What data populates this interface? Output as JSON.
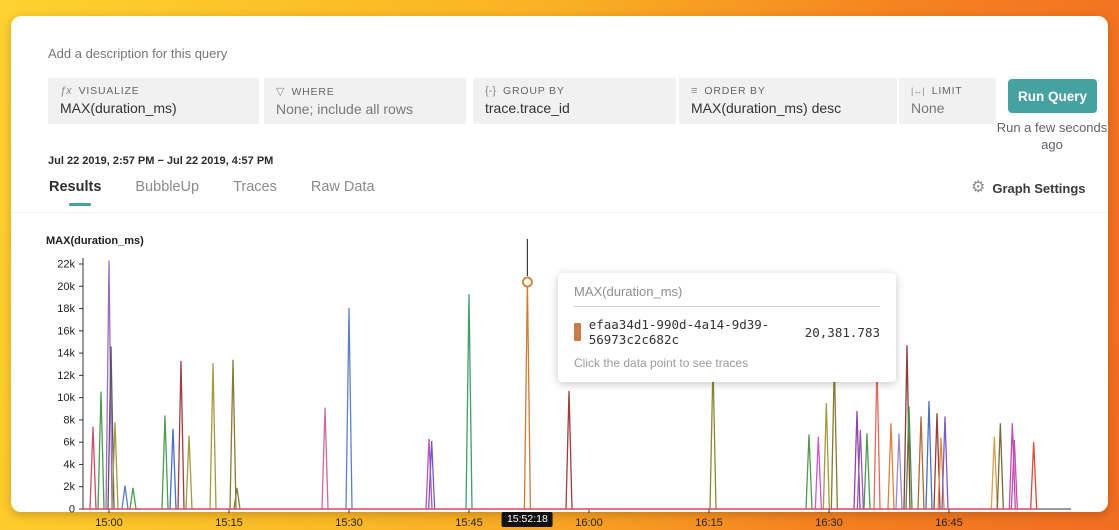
{
  "description_placeholder": "Add a description for this query",
  "query_builder": {
    "visualize": {
      "label": "VISUALIZE",
      "icon": "ƒx",
      "value": "MAX(duration_ms)"
    },
    "where": {
      "label": "WHERE",
      "icon": "▽",
      "value": "None; include all rows"
    },
    "group_by": {
      "label": "GROUP BY",
      "icon": "{-}",
      "value": "trace.trace_id"
    },
    "order_by": {
      "label": "ORDER BY",
      "icon": "≡",
      "value": "MAX(duration_ms) desc"
    },
    "limit": {
      "label": "LIMIT",
      "icon": "|↔|",
      "value": "None"
    },
    "run_button_label": "Run Query",
    "last_run_status": "Run a few seconds ago"
  },
  "time_range": "Jul 22 2019, 2:57 PM − Jul 22 2019, 4:57 PM",
  "tabs": [
    {
      "label": "Results",
      "active": true
    },
    {
      "label": "BubbleUp",
      "active": false
    },
    {
      "label": "Traces",
      "active": false
    },
    {
      "label": "Raw Data",
      "active": false
    }
  ],
  "graph_settings_label": "Graph Settings",
  "gear_icon": "⚙",
  "tooltip": {
    "title": "MAX(duration_ms)",
    "series_id": "efaa34d1-990d-4a14-9d39-56973c2c682c",
    "value": "20,381.783",
    "swatch_color": "#c87d4a",
    "hint": "Click the data point to see traces"
  },
  "selected_time_badge": "15:52:18",
  "colors": {
    "accent_teal": "#45a2a1",
    "zero_line_red": "#e0475a",
    "selected_orange": "#d07c35",
    "axis": "#333333"
  },
  "chart_data": {
    "type": "line",
    "title": "MAX(duration_ms)",
    "ylabel": "MAX(duration_ms)",
    "ylim": [
      0,
      22000
    ],
    "y_tick_labels": [
      "0",
      "2k",
      "4k",
      "6k",
      "8k",
      "10k",
      "12k",
      "14k",
      "16k",
      "18k",
      "20k",
      "22k"
    ],
    "x_ticks": [
      "15:00",
      "15:15",
      "15:30",
      "15:45",
      "16:00",
      "16:15",
      "16:30",
      "16:45"
    ],
    "grid": false,
    "legend": "tooltip-only",
    "points": [
      [
        "14:58:00",
        7400,
        "#c8506a"
      ],
      [
        "14:59:00",
        10550,
        "#4f9a4f"
      ],
      [
        "15:00:00",
        22300,
        "#9a6cc0"
      ],
      [
        "15:00:15",
        14600,
        "#5c5470"
      ],
      [
        "15:00:45",
        7800,
        "#a39a40"
      ],
      [
        "15:02:00",
        2100,
        "#5b7fc4"
      ],
      [
        "15:03:00",
        1900,
        "#4f9a4f"
      ],
      [
        "15:07:00",
        8400,
        "#4f9a4f"
      ],
      [
        "15:08:00",
        7200,
        "#4a6fc8"
      ],
      [
        "15:09:00",
        13300,
        "#a03c46"
      ],
      [
        "15:10:00",
        6600,
        "#a39a40"
      ],
      [
        "15:13:00",
        13100,
        "#a39a40"
      ],
      [
        "15:15:30",
        13400,
        "#8a7a35"
      ],
      [
        "15:16:00",
        1900,
        "#8a7a35"
      ],
      [
        "15:27:00",
        9100,
        "#d0689e"
      ],
      [
        "15:30:00",
        18050,
        "#5b82c8"
      ],
      [
        "15:40:00",
        6300,
        "#bc4fc4"
      ],
      [
        "15:40:20",
        6100,
        "#6c5bd0"
      ],
      [
        "15:45:00",
        19300,
        "#3f9d6e"
      ],
      [
        "15:52:18",
        20381.783,
        "#d07c35"
      ],
      [
        "15:57:30",
        10600,
        "#a03c3c"
      ],
      [
        "16:15:30",
        13100,
        "#8f8436"
      ],
      [
        "16:27:30",
        6700,
        "#4f9a4f"
      ],
      [
        "16:28:40",
        6500,
        "#d354c6"
      ],
      [
        "16:29:40",
        9500,
        "#a39a40"
      ],
      [
        "16:30:40",
        13100,
        "#857a30"
      ],
      [
        "16:33:30",
        8800,
        "#8e44ad"
      ],
      [
        "16:33:55",
        7100,
        "#9b59b6"
      ],
      [
        "16:34:45",
        6800,
        "#4f9a4f"
      ],
      [
        "16:36:00",
        13000,
        "#e06a5a"
      ],
      [
        "16:37:45",
        7700,
        "#e0803c"
      ],
      [
        "16:38:45",
        6800,
        "#9b87d0"
      ],
      [
        "16:39:45",
        14700,
        "#8e3a3a"
      ],
      [
        "16:40:00",
        9200,
        "#4a8c4a"
      ],
      [
        "16:41:30",
        8300,
        "#b06a3a"
      ],
      [
        "16:42:30",
        9700,
        "#4a6fc4"
      ],
      [
        "16:43:30",
        8600,
        "#9a3a3a"
      ],
      [
        "16:44:00",
        6400,
        "#e08a3c"
      ],
      [
        "16:44:30",
        8300,
        "#7a5bc4"
      ],
      [
        "16:50:40",
        6500,
        "#d8a04a"
      ],
      [
        "16:51:25",
        7700,
        "#7a6a3a"
      ],
      [
        "16:52:55",
        7700,
        "#c44bb0"
      ],
      [
        "16:53:10",
        6200,
        "#c44bb0"
      ],
      [
        "16:55:35",
        6000,
        "#d84a3a"
      ]
    ],
    "selected_index": 19,
    "selected_point": {
      "time": "15:52:18",
      "value": 20381.783,
      "series": "efaa34d1-990d-4a14-9d39-56973c2c682c"
    }
  }
}
